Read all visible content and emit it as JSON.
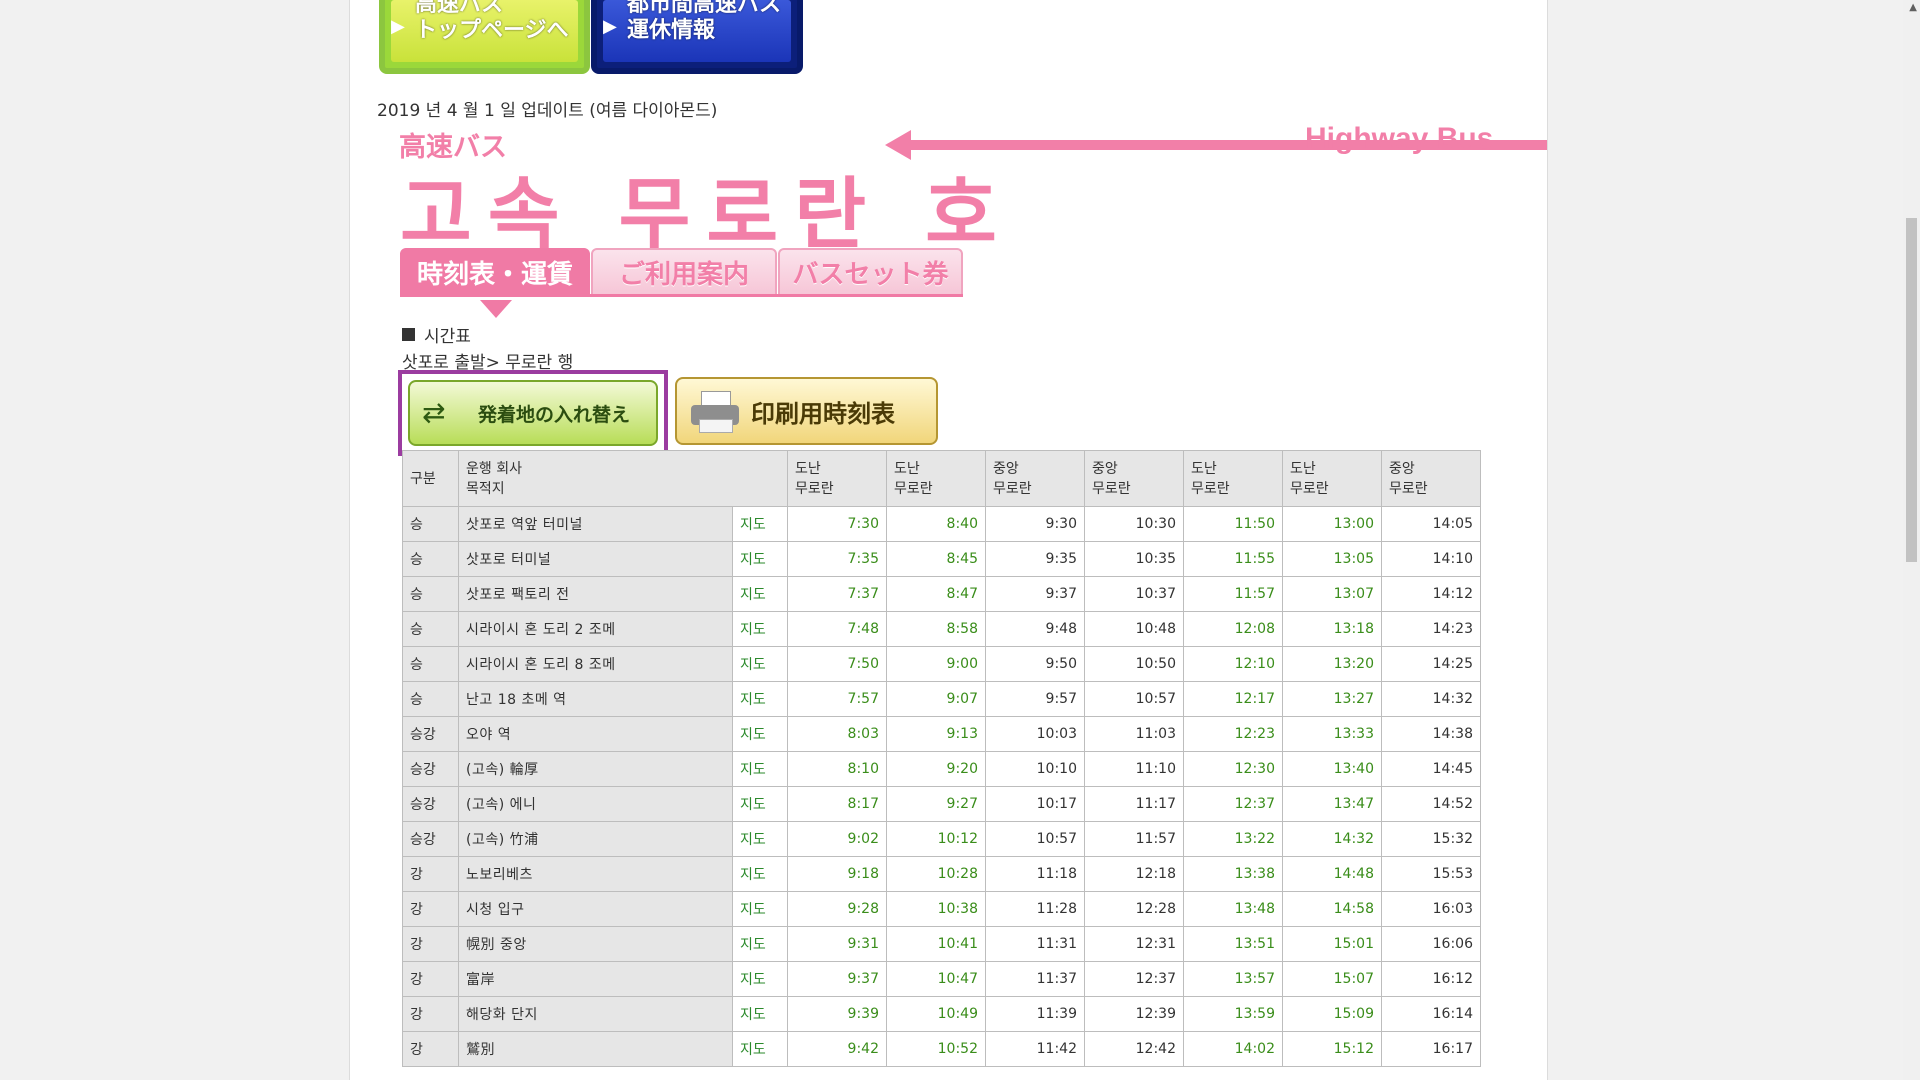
{
  "nav": {
    "top_button_1": "高速バス\nトップページへ",
    "top_button_2": "都市間高速バス\n運休情報"
  },
  "update_text": "2019 년 4 월 1 일 업데이트 (여름 다이아몬드)",
  "title": {
    "sub": "高速バス",
    "en": "Highway Bus",
    "main": "고속 무로란 호"
  },
  "tabs": [
    {
      "label": "時刻表・運賃"
    },
    {
      "label": "ご利用案内"
    },
    {
      "label": "バスセット券"
    }
  ],
  "section_heading": "시간표",
  "route_text": "삿포로 출발> 무로란 행",
  "buttons": {
    "swap": "発着地の入れ替え",
    "print": "印刷用時刻表"
  },
  "table": {
    "headers": {
      "kind": "구분",
      "company": "운행 회사",
      "destination": "목적지",
      "trips": [
        "도난\n무로란",
        "도난\n무로란",
        "중앙\n무로란",
        "중앙\n무로란",
        "도난\n무로란",
        "도난\n무로란",
        "중앙\n무로란"
      ]
    },
    "map_label": "지도",
    "rows": [
      {
        "kind": "승",
        "stop": "삿포로 역앞 터미널",
        "times": [
          "7:30",
          "8:40",
          "9:30",
          "10:30",
          "11:50",
          "13:00",
          "14:05"
        ]
      },
      {
        "kind": "승",
        "stop": "삿포로 터미널",
        "times": [
          "7:35",
          "8:45",
          "9:35",
          "10:35",
          "11:55",
          "13:05",
          "14:10"
        ]
      },
      {
        "kind": "승",
        "stop": "삿포로 팩토리 전",
        "times": [
          "7:37",
          "8:47",
          "9:37",
          "10:37",
          "11:57",
          "13:07",
          "14:12"
        ]
      },
      {
        "kind": "승",
        "stop": "시라이시 혼 도리 2 조메",
        "times": [
          "7:48",
          "8:58",
          "9:48",
          "10:48",
          "12:08",
          "13:18",
          "14:23"
        ]
      },
      {
        "kind": "승",
        "stop": "시라이시 혼 도리 8 조메",
        "times": [
          "7:50",
          "9:00",
          "9:50",
          "10:50",
          "12:10",
          "13:20",
          "14:25"
        ]
      },
      {
        "kind": "승",
        "stop": "난고 18 초메 역",
        "times": [
          "7:57",
          "9:07",
          "9:57",
          "10:57",
          "12:17",
          "13:27",
          "14:32"
        ]
      },
      {
        "kind": "승강",
        "stop": "오야 역",
        "times": [
          "8:03",
          "9:13",
          "10:03",
          "11:03",
          "12:23",
          "13:33",
          "14:38"
        ]
      },
      {
        "kind": "승강",
        "stop": "(고속) 輪厚",
        "times": [
          "8:10",
          "9:20",
          "10:10",
          "11:10",
          "12:30",
          "13:40",
          "14:45"
        ]
      },
      {
        "kind": "승강",
        "stop": "(고속) 에니",
        "times": [
          "8:17",
          "9:27",
          "10:17",
          "11:17",
          "12:37",
          "13:47",
          "14:52"
        ]
      },
      {
        "kind": "승강",
        "stop": "(고속) 竹浦",
        "times": [
          "9:02",
          "10:12",
          "10:57",
          "11:57",
          "13:22",
          "14:32",
          "15:32"
        ]
      },
      {
        "kind": "강",
        "stop": "노보리베츠",
        "times": [
          "9:18",
          "10:28",
          "11:18",
          "12:18",
          "13:38",
          "14:48",
          "15:53"
        ]
      },
      {
        "kind": "강",
        "stop": "시청 입구",
        "times": [
          "9:28",
          "10:38",
          "11:28",
          "12:28",
          "13:48",
          "14:58",
          "16:03"
        ]
      },
      {
        "kind": "강",
        "stop": "幌別 중앙",
        "times": [
          "9:31",
          "10:41",
          "11:31",
          "12:31",
          "13:51",
          "15:01",
          "16:06"
        ]
      },
      {
        "kind": "강",
        "stop": "富岸",
        "times": [
          "9:37",
          "10:47",
          "11:37",
          "12:37",
          "13:57",
          "15:07",
          "16:12"
        ]
      },
      {
        "kind": "강",
        "stop": "해당화 단지",
        "times": [
          "9:39",
          "10:49",
          "11:39",
          "12:39",
          "13:59",
          "15:09",
          "16:14"
        ]
      },
      {
        "kind": "강",
        "stop": "鷲別",
        "times": [
          "9:42",
          "10:52",
          "11:42",
          "12:42",
          "14:02",
          "15:12",
          "16:17"
        ]
      }
    ],
    "green_columns": [
      0,
      1,
      4,
      5
    ]
  },
  "colors": {
    "brand_pink": "#f27fa8",
    "time_green": "#3a8d1a",
    "highlight_purple": "#9b3ca0"
  }
}
